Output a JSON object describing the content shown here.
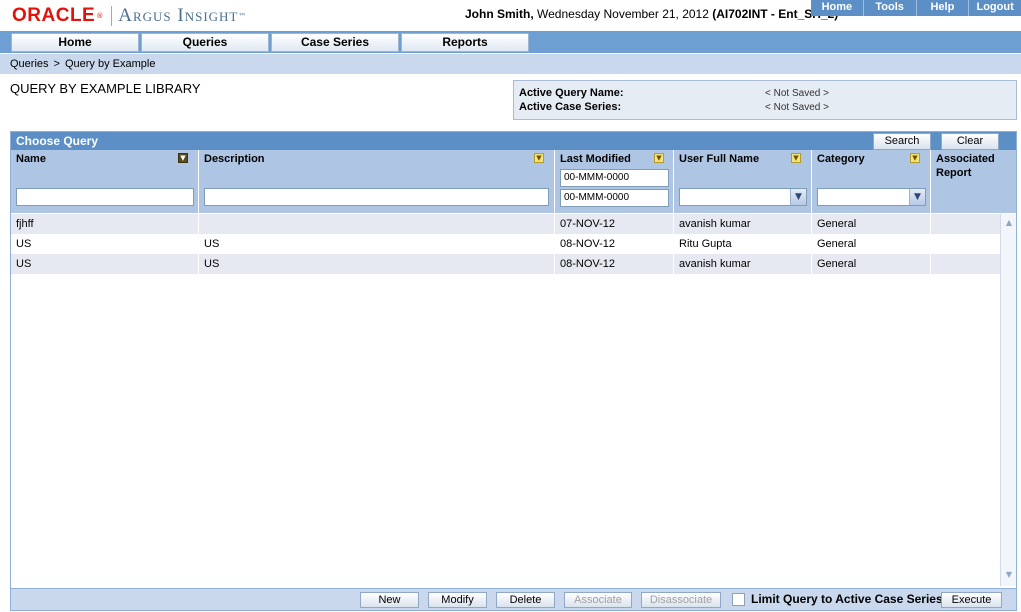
{
  "header": {
    "brand": "ORACLE",
    "brand_reg": "®",
    "product": "Argus Insight",
    "product_tm": "™",
    "user_name": "John Smith,",
    "date_text": "Wednesday November 21, 2012",
    "env": "(AI702INT - Ent_SH_2)",
    "links": [
      "Home",
      "Tools",
      "Help",
      "Logout"
    ]
  },
  "nav": {
    "tabs": [
      "Home",
      "Queries",
      "Case Series",
      "Reports"
    ]
  },
  "breadcrumb": {
    "items": [
      "Queries",
      "Query by Example"
    ],
    "separator": ">"
  },
  "page": {
    "title": "QUERY BY EXAMPLE LIBRARY"
  },
  "active": {
    "query_label": "Active Query Name:",
    "query_value": "< Not Saved >",
    "series_label": "Active Case Series:",
    "series_value": "< Not Saved >"
  },
  "panel": {
    "title": "Choose Query",
    "search_label": "Search",
    "clear_label": "Clear"
  },
  "columns": {
    "name": "Name",
    "description": "Description",
    "last_modified": "Last Modified",
    "user_full_name": "User Full Name",
    "category": "Category",
    "associated_report": "Associated Report"
  },
  "filters": {
    "date_from": "00-MMM-0000",
    "date_to": "00-MMM-0000"
  },
  "rows": [
    {
      "name": "fjhff",
      "description": "",
      "last_modified": "07-NOV-12",
      "user": "avanish kumar",
      "category": "General",
      "report": ""
    },
    {
      "name": "US",
      "description": "US",
      "last_modified": "08-NOV-12",
      "user": "Ritu Gupta",
      "category": "General",
      "report": ""
    },
    {
      "name": "US",
      "description": "US",
      "last_modified": "08-NOV-12",
      "user": "avanish kumar",
      "category": "General",
      "report": ""
    }
  ],
  "footer": {
    "new": "New",
    "modify": "Modify",
    "delete": "Delete",
    "associate": "Associate",
    "disassociate": "Disassociate",
    "limit_label": "Limit Query to Active Case Series",
    "execute": "Execute"
  }
}
